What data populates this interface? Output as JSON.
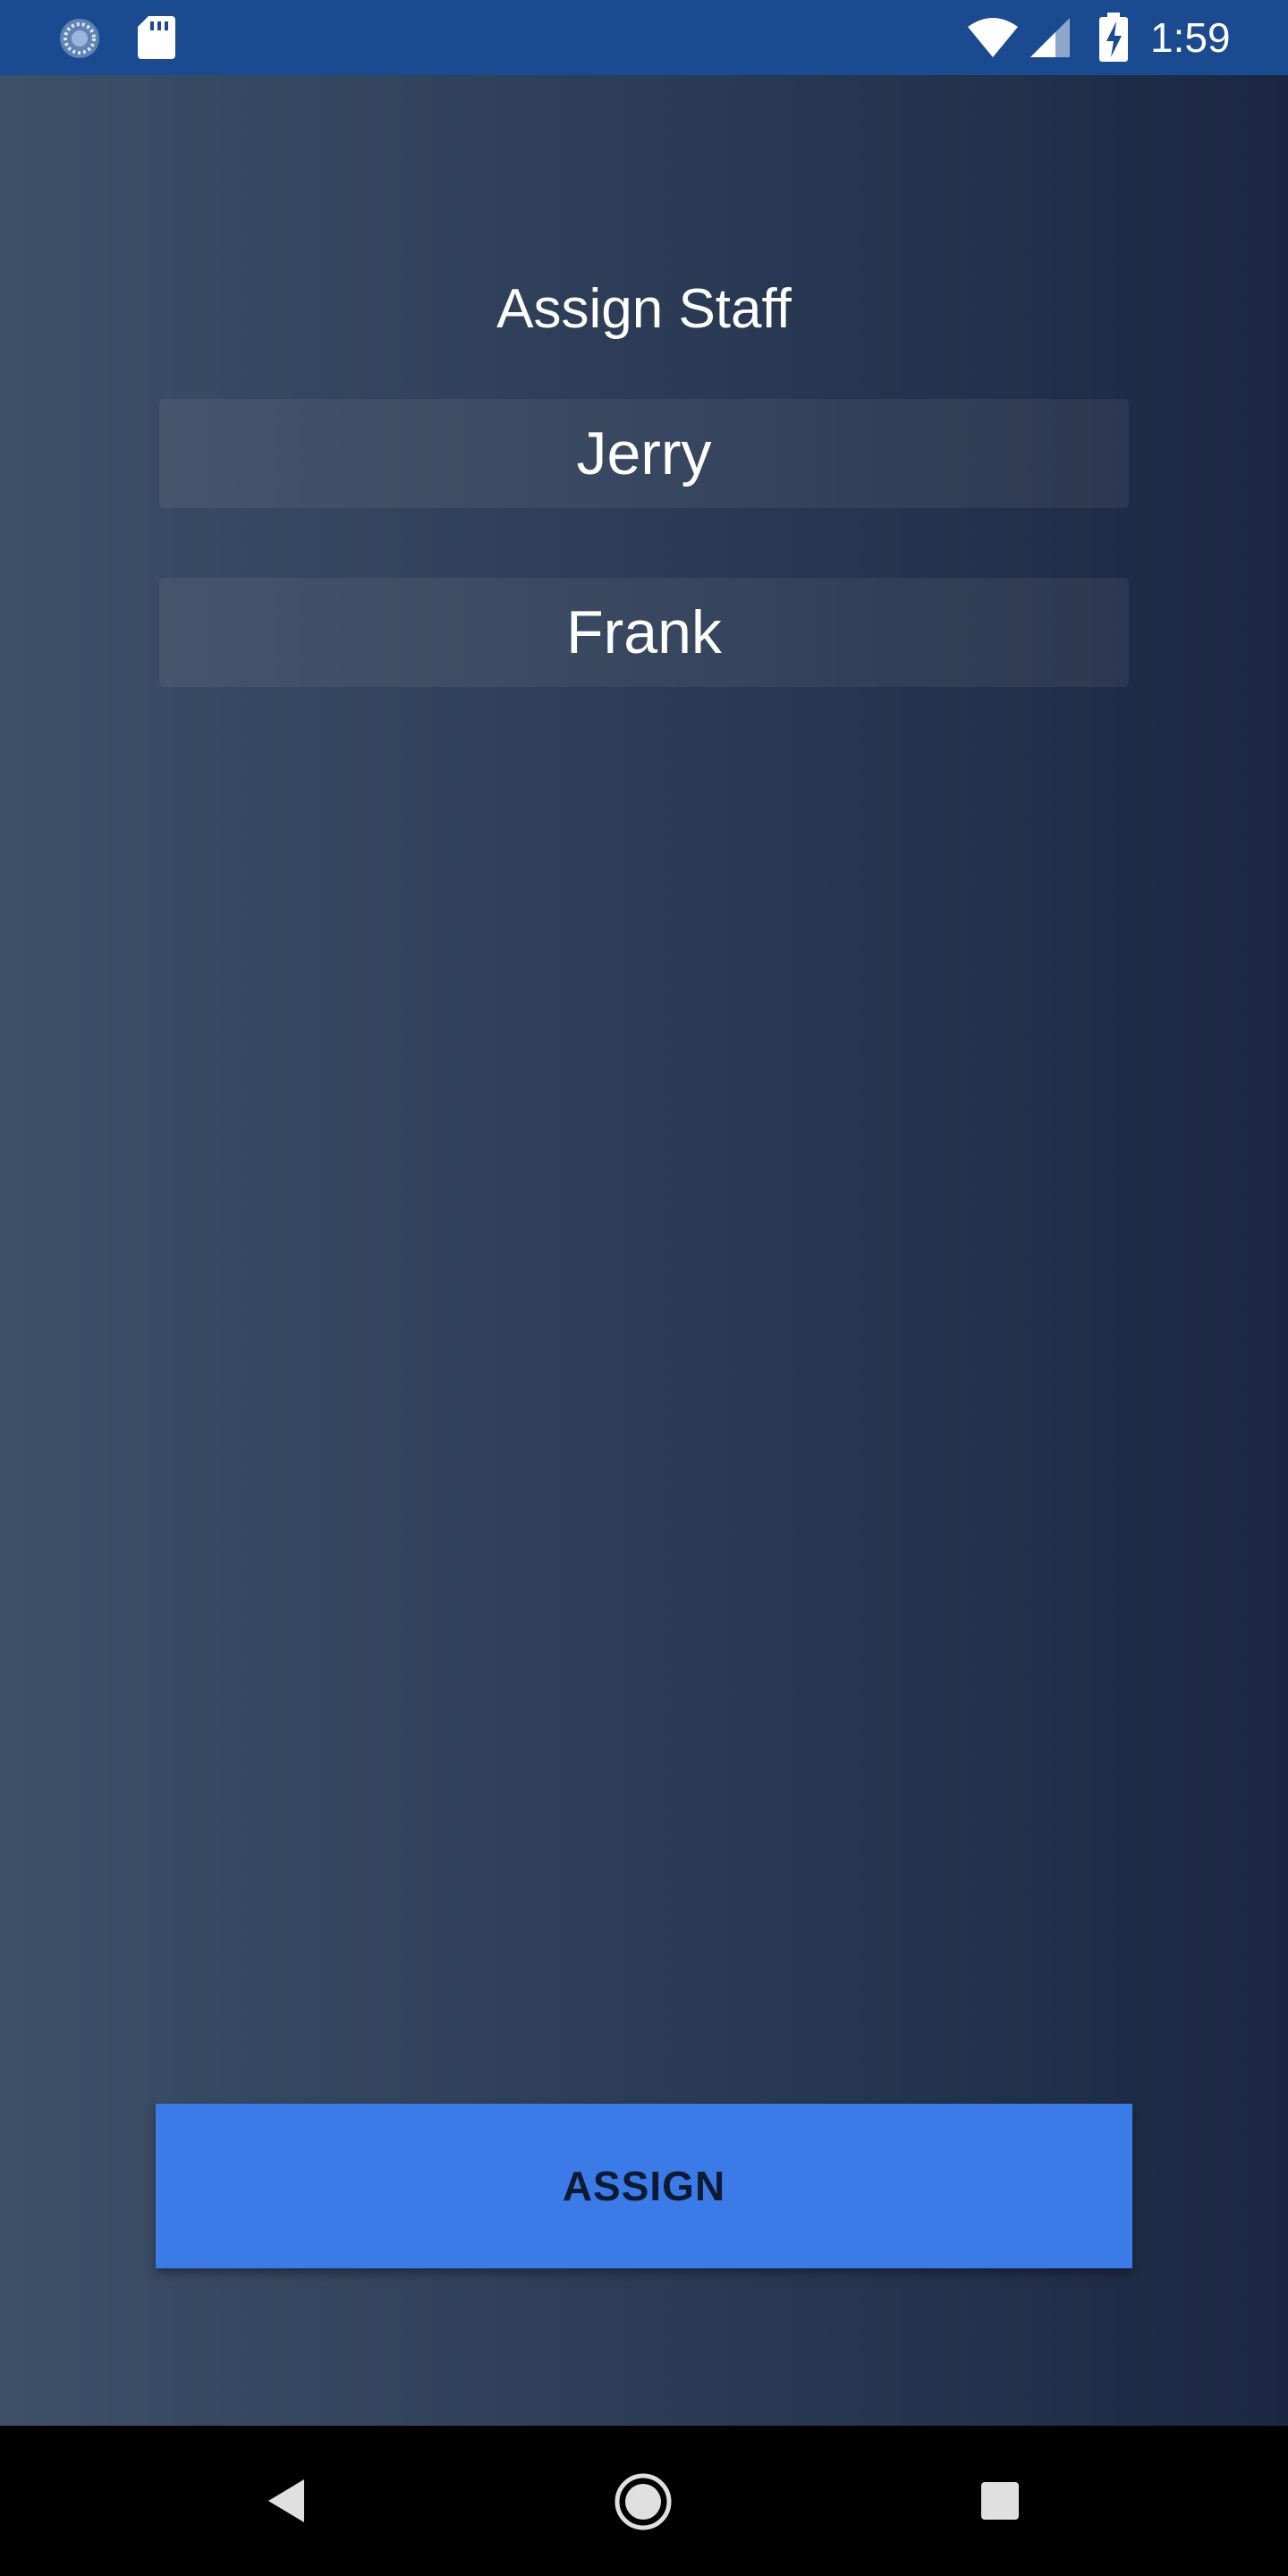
{
  "status_bar": {
    "time": "1:59",
    "icons": [
      "sync-icon",
      "sd-card-icon",
      "wifi-icon",
      "cell-signal-icon",
      "battery-charging-icon"
    ],
    "background": "#1a4a90"
  },
  "screen": {
    "title": "Assign Staff",
    "staff": [
      {
        "name": "Jerry"
      },
      {
        "name": "Frank"
      }
    ],
    "assign_button_label": "ASSIGN"
  },
  "colors": {
    "accent": "#3b7be8",
    "gradient_start": "#3d5068",
    "gradient_end": "#1b2742"
  },
  "nav_bar": {
    "icons": [
      "back-icon",
      "home-icon",
      "recents-icon"
    ]
  }
}
